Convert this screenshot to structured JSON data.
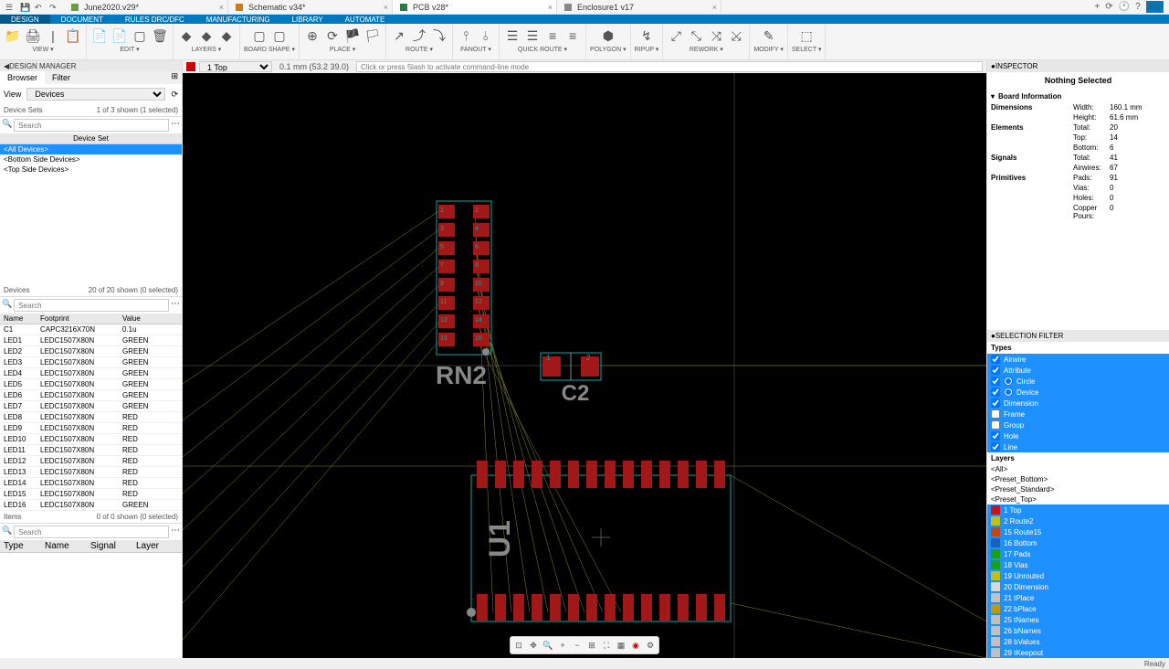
{
  "title_tabs": [
    {
      "label": "June2020.v29*",
      "icon": "#6a9e3f",
      "active": false
    },
    {
      "label": "Schematic v34*",
      "icon": "#c77d1a",
      "active": false
    },
    {
      "label": "PCB v28*",
      "icon": "#2a7d3f",
      "active": true
    },
    {
      "label": "Enclosure1 v17",
      "icon": "#888",
      "active": false
    }
  ],
  "menubar": [
    "DESIGN",
    "DOCUMENT",
    "RULES DRC/DFC",
    "MANUFACTURING",
    "LIBRARY",
    "AUTOMATE"
  ],
  "menubar_active": 0,
  "toolbar_groups": [
    {
      "label": "VIEW ▾",
      "icons": [
        "📁",
        "🖨",
        "|",
        "📋"
      ]
    },
    {
      "label": "EDIT ▾",
      "icons": [
        "📄",
        "📄",
        "▢",
        "🗑"
      ]
    },
    {
      "label": "LAYERS ▾",
      "icons": [
        "◆",
        "◆",
        "◆"
      ]
    },
    {
      "label": "BOARD SHAPE ▾",
      "icons": [
        "▢",
        "▢"
      ]
    },
    {
      "label": "PLACE ▾",
      "icons": [
        "⊕",
        "⟳",
        "🏴",
        "🏳"
      ]
    },
    {
      "label": "ROUTE ▾",
      "icons": [
        "↗",
        "⤴",
        "⤵"
      ]
    },
    {
      "label": "FANOUT ▾",
      "icons": [
        "⫯",
        "⫰"
      ]
    },
    {
      "label": "QUICK ROUTE ▾",
      "icons": [
        "☰",
        "☰",
        "≡",
        "≡"
      ]
    },
    {
      "label": "POLYGON ▾",
      "icons": [
        "⬢"
      ]
    },
    {
      "label": "RIPUP ▾",
      "icons": [
        "↯"
      ]
    },
    {
      "label": "REWORK ▾",
      "icons": [
        "⤢",
        "⤡",
        "⤨",
        "⤩"
      ]
    },
    {
      "label": "MODIFY ▾",
      "icons": [
        "✎"
      ]
    },
    {
      "label": "SELECT ▾",
      "icons": [
        "⬚"
      ]
    }
  ],
  "left": {
    "panel_title": "DESIGN MANAGER",
    "tabs": [
      "Browser",
      "Filter"
    ],
    "view_label": "View",
    "view_value": "Devices",
    "device_sets": {
      "header": "Device Sets",
      "count": "1 of 3 shown (1 selected)",
      "col": "Device Set",
      "items": [
        {
          "t": "<All Devices>",
          "sel": true
        },
        {
          "t": "<Bottom Side Devices>",
          "sel": false
        },
        {
          "t": "<Top Side Devices>",
          "sel": false
        }
      ]
    },
    "devices": {
      "header": "Devices",
      "count": "20 of 20 shown (0 selected)",
      "cols": [
        "Name",
        "Footprint",
        "Value"
      ],
      "rows": [
        [
          "C1",
          "CAPC3216X70N",
          "0.1u"
        ],
        [
          "LED1",
          "LEDC1507X80N",
          "GREEN"
        ],
        [
          "LED2",
          "LEDC1507X80N",
          "GREEN"
        ],
        [
          "LED3",
          "LEDC1507X80N",
          "GREEN"
        ],
        [
          "LED4",
          "LEDC1507X80N",
          "GREEN"
        ],
        [
          "LED5",
          "LEDC1507X80N",
          "GREEN"
        ],
        [
          "LED6",
          "LEDC1507X80N",
          "GREEN"
        ],
        [
          "LED7",
          "LEDC1507X80N",
          "GREEN"
        ],
        [
          "LED8",
          "LEDC1507X80N",
          "RED"
        ],
        [
          "LED9",
          "LEDC1507X80N",
          "RED"
        ],
        [
          "LED10",
          "LEDC1507X80N",
          "RED"
        ],
        [
          "LED11",
          "LEDC1507X80N",
          "RED"
        ],
        [
          "LED12",
          "LEDC1507X80N",
          "RED"
        ],
        [
          "LED13",
          "LEDC1507X80N",
          "RED"
        ],
        [
          "LED14",
          "LEDC1507X80N",
          "RED"
        ],
        [
          "LED15",
          "LEDC1507X80N",
          "RED"
        ],
        [
          "LED16",
          "LEDC1507X80N",
          "GREEN"
        ]
      ]
    },
    "items": {
      "header": "Items",
      "count": "0 of 0 shown (0 selected)",
      "cols": [
        "Type",
        "Name",
        "Signal",
        "Layer"
      ]
    }
  },
  "center": {
    "layer": "1 Top",
    "coord": "0.1 mm (53.2 39.0)",
    "cmd_placeholder": "Click or press Slash to activate command-line mode",
    "labels": {
      "rn2": "RN2",
      "c2": "C2",
      "u1": "U1"
    }
  },
  "right": {
    "inspector": "INSPECTOR",
    "nothing": "Nothing Selected",
    "board_info": "Board Information",
    "dimensions": {
      "k": "Dimensions",
      "rows": [
        [
          "Width:",
          "160.1 mm"
        ],
        [
          "Height:",
          "61.6 mm"
        ]
      ]
    },
    "elements": {
      "k": "Elements",
      "rows": [
        [
          "Total:",
          "20"
        ],
        [
          "Top:",
          "14"
        ],
        [
          "Bottom:",
          "6"
        ]
      ]
    },
    "signals": {
      "k": "Signals",
      "rows": [
        [
          "Total:",
          "41"
        ],
        [
          "Airwires:",
          "67"
        ]
      ]
    },
    "primitives": {
      "k": "Primitives",
      "rows": [
        [
          "Pads:",
          "91"
        ],
        [
          "Vias:",
          "0"
        ],
        [
          "Holes:",
          "0"
        ],
        [
          "Copper Pours:",
          "0"
        ]
      ]
    },
    "selfilter": "SELECTION FILTER",
    "types": "Types",
    "filter_items": [
      {
        "t": "Airwire",
        "c": true
      },
      {
        "t": "Attribute",
        "c": true
      },
      {
        "t": "Circle",
        "c": true,
        "r": true
      },
      {
        "t": "Device",
        "c": true,
        "r": true
      },
      {
        "t": "Dimension",
        "c": true
      },
      {
        "t": "Frame",
        "c": false
      },
      {
        "t": "Group",
        "c": false
      },
      {
        "t": "Hole",
        "c": true
      },
      {
        "t": "Line",
        "c": true
      }
    ],
    "layers_h": "Layers",
    "layers_presets": [
      "<All>",
      "<Preset_Bottom>",
      "<Preset_Standard>",
      "<Preset_Top>"
    ],
    "layers_list": [
      {
        "n": "1 Top",
        "c": "#c01818"
      },
      {
        "n": "2 Route2",
        "c": "#c0c018"
      },
      {
        "n": "15 Route15",
        "c": "#c04818"
      },
      {
        "n": "16 Bottom",
        "c": "#1860c0"
      },
      {
        "n": "17 Pads",
        "c": "#18a018"
      },
      {
        "n": "18 Vias",
        "c": "#18a018"
      },
      {
        "n": "19 Unrouted",
        "c": "#c0c018"
      },
      {
        "n": "20 Dimension",
        "c": "#d8d8d8"
      },
      {
        "n": "21 tPlace",
        "c": "#c0c0c0"
      },
      {
        "n": "22 bPlace",
        "c": "#c09818"
      },
      {
        "n": "25 tNames",
        "c": "#c0c0c0"
      },
      {
        "n": "26 bNames",
        "c": "#c0c0c0"
      },
      {
        "n": "28 bValues",
        "c": "#c0c0c0"
      },
      {
        "n": "29 tKeepout",
        "c": "#c0c0c0"
      }
    ]
  },
  "status": "Ready"
}
